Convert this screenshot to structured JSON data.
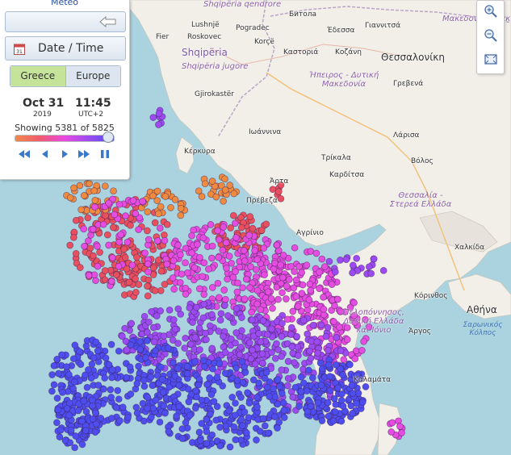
{
  "panel": {
    "title": "Meteo",
    "datetime_label": "Date / Time",
    "tabs": [
      "Greece",
      "Europe"
    ],
    "active_tab": "Greece",
    "date": "Oct 31",
    "year": "2019",
    "time": "11:45",
    "timezone": "UTC+2",
    "showing_prefix": "Showing",
    "showing_count": "5381",
    "showing_of": "of",
    "showing_total": "5825",
    "slider_level": 0.94
  },
  "icons": [
    "back-arrow-icon",
    "calendar-icon",
    "rewind-icon",
    "step-back-icon",
    "step-forward-icon",
    "fast-forward-icon",
    "pause-icon",
    "zoom-in-icon",
    "zoom-out-icon",
    "zoom-extent-icon"
  ],
  "map_labels": [
    {
      "text": "Shqipëria qendrore",
      "kind": "region"
    },
    {
      "text": "Lushnjë"
    },
    {
      "text": "Fier"
    },
    {
      "text": "Roskovec"
    },
    {
      "text": "Pogradec"
    },
    {
      "text": "Korçë"
    },
    {
      "text": "Shqipëria",
      "kind": "country"
    },
    {
      "text": "Shqipëria jugore",
      "kind": "region"
    },
    {
      "text": "Gjirokastër"
    },
    {
      "text": "Битола"
    },
    {
      "text": "Γιαννιτσά"
    },
    {
      "text": "Έδεσσα"
    },
    {
      "text": "Καστοριά"
    },
    {
      "text": "Κοζάνη"
    },
    {
      "text": "Μακεδονία Θράκη",
      "kind": "region"
    },
    {
      "text": "Θεσσαλονίκη",
      "kind": "big"
    },
    {
      "text": "Ήπειρος - Δυτική Μακεδονία",
      "kind": "region"
    },
    {
      "text": "Γρεβενά"
    },
    {
      "text": "Ιωάννινα"
    },
    {
      "text": "Κέρκυρα"
    },
    {
      "text": "Λάρισα"
    },
    {
      "text": "Τρίκαλα"
    },
    {
      "text": "Καρδίτσα"
    },
    {
      "text": "Βόλος"
    },
    {
      "text": "Άρτα"
    },
    {
      "text": "Πρέβεζα"
    },
    {
      "text": "Θεσσαλία - Στερεά Ελλάδα",
      "kind": "region"
    },
    {
      "text": "Αγρίνιο"
    },
    {
      "text": "Χαλκίδα"
    },
    {
      "text": "Κόρινθος"
    },
    {
      "text": "Αθήνα",
      "kind": "big"
    },
    {
      "text": "Σαρωνικός Κόλπος",
      "kind": "sea"
    },
    {
      "text": "Πελοπόννησος, Δυτική Ελλάδα και Ιόνιο",
      "kind": "region"
    },
    {
      "text": "Άργος"
    },
    {
      "text": "Καλαμάτα"
    }
  ],
  "colors": {
    "sea": "#aad3df",
    "land": "#f2efe9",
    "orange": "#ef8a3f",
    "red": "#e8505f",
    "magenta": "#e54ce0",
    "purple": "#9c4bf2",
    "blue": "#4e4ef0",
    "active_tab": "#c6e39a"
  }
}
